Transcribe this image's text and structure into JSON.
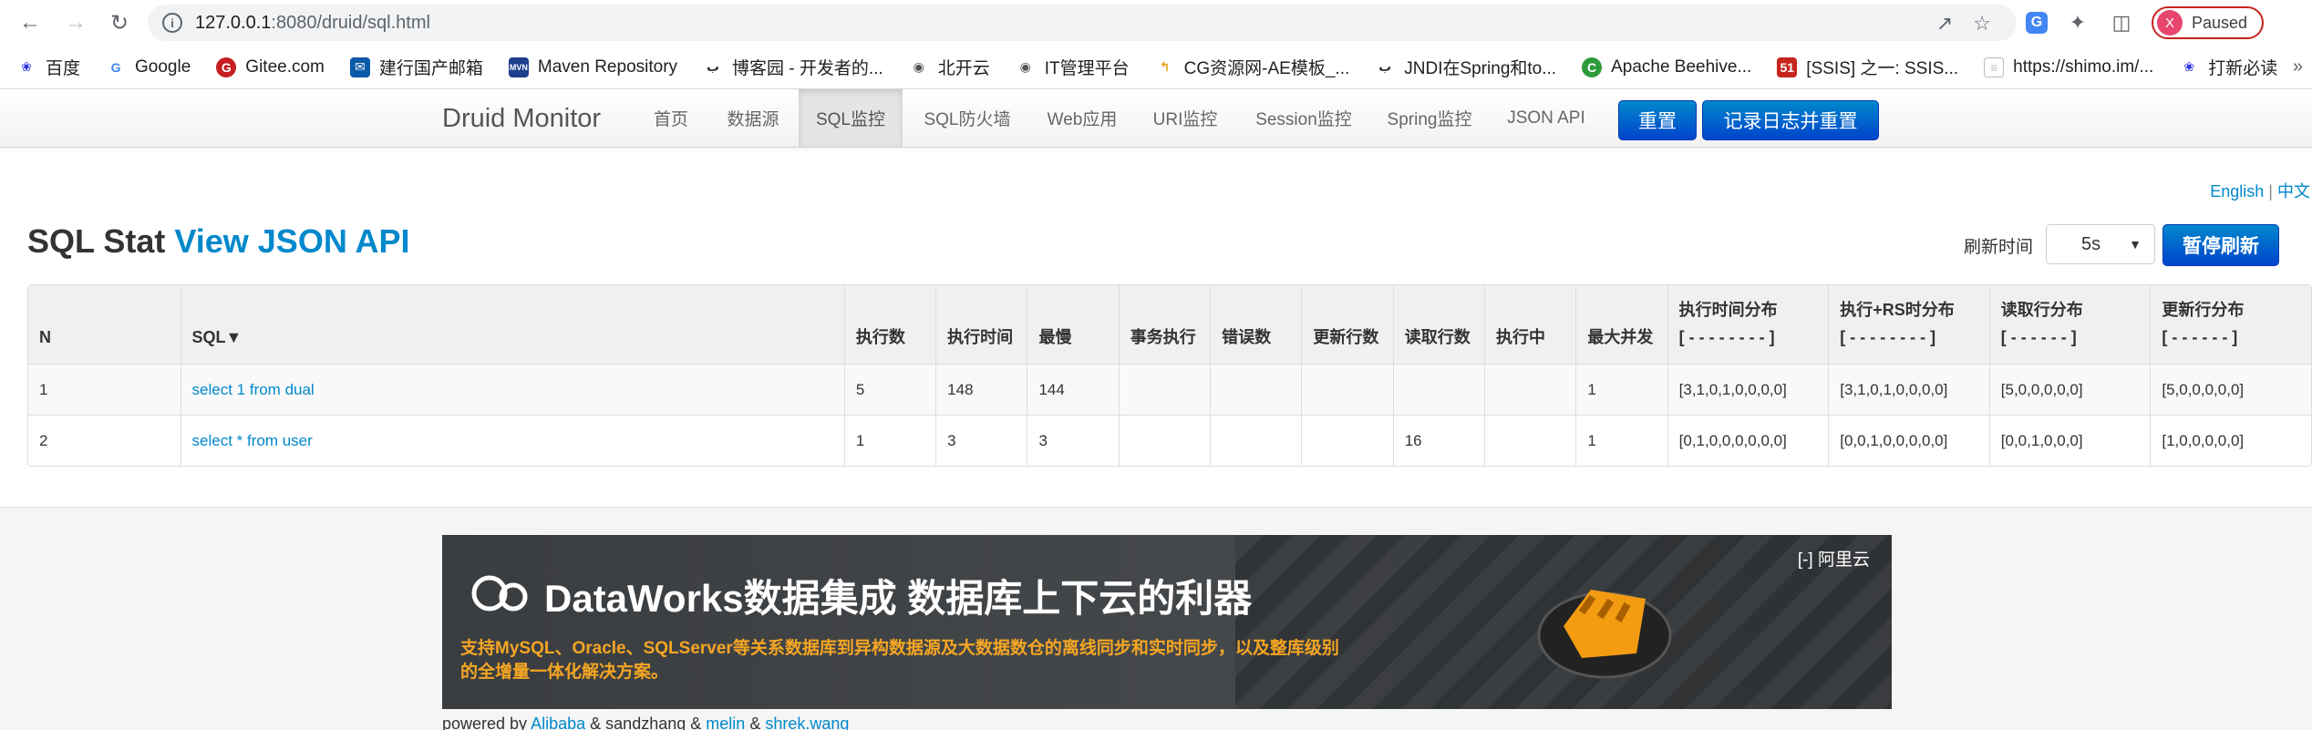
{
  "browser": {
    "url_host": "127.0.0.1",
    "url_rest": ":8080/druid/sql.html",
    "profile_initial": "X",
    "profile_label": "Paused"
  },
  "bookmarks": [
    {
      "label": "百度",
      "icon": "baidu-paw-icon"
    },
    {
      "label": "Google",
      "icon": "google-g-icon"
    },
    {
      "label": "Gitee.com",
      "icon": "gitee-icon"
    },
    {
      "label": "建行国产邮箱",
      "icon": "mail-icon"
    },
    {
      "label": "Maven Repository",
      "icon": "maven-icon"
    },
    {
      "label": "博客园 - 开发者的...",
      "icon": "cnblogs-icon"
    },
    {
      "label": "北开云",
      "icon": "globe-icon"
    },
    {
      "label": "IT管理平台",
      "icon": "globe-icon"
    },
    {
      "label": "CG资源网-AE模板_...",
      "icon": "cg-icon"
    },
    {
      "label": "JNDI在Spring和to...",
      "icon": "cnblogs-icon"
    },
    {
      "label": "Apache Beehive...",
      "icon": "apache-icon"
    },
    {
      "label": "[SSIS] 之一: SSIS...",
      "icon": "csdn-icon"
    },
    {
      "label": "https://shimo.im/...",
      "icon": "page-icon"
    },
    {
      "label": "打新必读",
      "icon": "paw-icon"
    }
  ],
  "druid_nav": {
    "brand": "Druid Monitor",
    "items": [
      "首页",
      "数据源",
      "SQL监控",
      "SQL防火墙",
      "Web应用",
      "URI监控",
      "Session监控",
      "Spring监控",
      "JSON API"
    ],
    "reset": "重置",
    "log_reset": "记录日志并重置"
  },
  "lang": {
    "en": "English",
    "sep": "|",
    "zh": "中文"
  },
  "page": {
    "title": "SQL Stat",
    "json_link": "View JSON API",
    "refresh_label": "刷新时间",
    "refresh_value": "5s",
    "pause_btn": "暂停刷新"
  },
  "table": {
    "headers": [
      "N",
      "SQL▼",
      "执行数",
      "执行时间",
      "最慢",
      "事务执行",
      "错误数",
      "更新行数",
      "读取行数",
      "执行中",
      "最大并发",
      "执行时间分布",
      "执行+RS时分布",
      "读取行分布",
      "更新行分布"
    ],
    "header_sub": [
      "",
      "",
      "",
      "",
      "",
      "",
      "",
      "",
      "",
      "",
      "",
      "[ - - - - - - - - ]",
      "[ - - - - - - - - ]",
      "[ - - - - - - ]",
      "[ - - - - - - ]"
    ],
    "rows": [
      [
        "1",
        "select 1 from dual",
        "5",
        "148",
        "144",
        "",
        "",
        "",
        "",
        "",
        "1",
        "[3,1,0,1,0,0,0,0]",
        "[3,1,0,1,0,0,0,0]",
        "[5,0,0,0,0,0]",
        "[5,0,0,0,0,0]"
      ],
      [
        "2",
        "select * from user",
        "1",
        "3",
        "3",
        "",
        "",
        "",
        "16",
        "",
        "1",
        "[0,1,0,0,0,0,0,0]",
        "[0,0,1,0,0,0,0,0]",
        "[0,0,1,0,0,0]",
        "[1,0,0,0,0,0]"
      ]
    ]
  },
  "banner": {
    "headline": "DataWorks数据集成 数据库上下云的利器",
    "sub": "支持MySQL、Oracle、SQLServer等关系数据库到异构数据源及大数据数仓的离线同步和实时同步，以及整库级别的全增量一体化解决方案。",
    "brand": "阿里云"
  },
  "footer": {
    "prefix": "powered by",
    "a1": "Alibaba",
    "amp1": "&",
    "t2": "sandzhang",
    "amp2": "&",
    "a3": "melin",
    "amp3": "&",
    "a4": "shrek.wang"
  }
}
